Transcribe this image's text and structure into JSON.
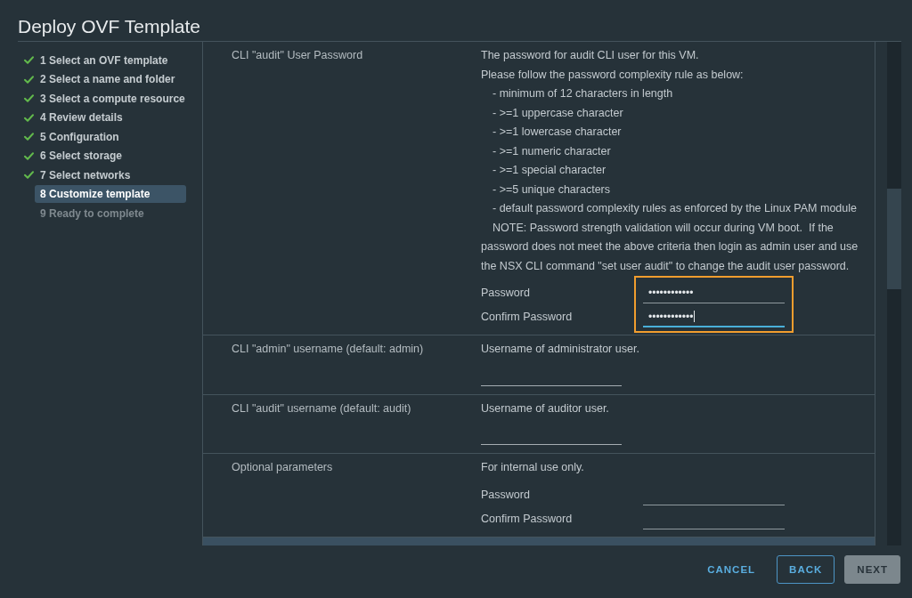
{
  "window": {
    "title": "Deploy OVF Template"
  },
  "steps": [
    {
      "label": "1 Select an OVF template",
      "done": true,
      "selected": false,
      "disabled": false
    },
    {
      "label": "2 Select a name and folder",
      "done": true,
      "selected": false,
      "disabled": false
    },
    {
      "label": "3 Select a compute resource",
      "done": true,
      "selected": false,
      "disabled": false
    },
    {
      "label": "4 Review details",
      "done": true,
      "selected": false,
      "disabled": false
    },
    {
      "label": "5 Configuration",
      "done": true,
      "selected": false,
      "disabled": false
    },
    {
      "label": "6 Select storage",
      "done": true,
      "selected": false,
      "disabled": false
    },
    {
      "label": "7 Select networks",
      "done": true,
      "selected": false,
      "disabled": false
    },
    {
      "label": "8 Customize template",
      "done": false,
      "selected": true,
      "disabled": false
    },
    {
      "label": "9 Ready to complete",
      "done": false,
      "selected": false,
      "disabled": true
    }
  ],
  "sections": [
    {
      "kind": "credentials",
      "label": "CLI \"audit\" User Password",
      "description": [
        {
          "kind": "para",
          "text": "The password for audit CLI user for this VM."
        },
        {
          "kind": "para",
          "text": "Please follow the password complexity rule as below:"
        },
        {
          "kind": "item",
          "text": "- minimum of 12 characters in length"
        },
        {
          "kind": "item",
          "text": "- >=1 uppercase character"
        },
        {
          "kind": "item",
          "text": "- >=1 lowercase character"
        },
        {
          "kind": "item",
          "text": "- >=1 numeric character"
        },
        {
          "kind": "item",
          "text": "- >=1 special character"
        },
        {
          "kind": "item",
          "text": "- >=5 unique characters"
        },
        {
          "kind": "item",
          "text": "- default password complexity rules as enforced by the Linux PAM module"
        },
        {
          "kind": "note",
          "text": "NOTE: Password strength validation will occur during VM boot.  If the password does not meet the above criteria then login as admin user and use the NSX CLI command \"set user audit\" to change the audit user password."
        }
      ],
      "highlighted": true,
      "fields": [
        {
          "label": "Password",
          "value": "••••••••••••",
          "focused": false
        },
        {
          "label": "Confirm Password",
          "value": "••••••••••••",
          "focused": true
        }
      ]
    },
    {
      "kind": "input",
      "label": "CLI \"admin\" username (default: admin)",
      "description": [
        {
          "kind": "para",
          "text": "Username of administrator user."
        }
      ],
      "fields": [
        {
          "focused": false
        }
      ]
    },
    {
      "kind": "input",
      "label": "CLI \"audit\" username (default: audit)",
      "description": [
        {
          "kind": "para",
          "text": "Username of auditor user."
        }
      ],
      "fields": [
        {
          "focused": false
        }
      ]
    },
    {
      "kind": "credentials",
      "label": "Optional parameters",
      "description": [
        {
          "kind": "para",
          "text": "For internal use only."
        }
      ],
      "fields": [
        {
          "label": "Password",
          "focused": false
        },
        {
          "label": "Confirm Password",
          "focused": false
        }
      ]
    },
    {
      "kind": "group"
    }
  ],
  "footer": {
    "buttons": [
      {
        "kind": "cancel",
        "label": "CANCEL",
        "disabled": false
      },
      {
        "kind": "back",
        "label": "BACK",
        "disabled": false
      },
      {
        "kind": "next",
        "label": "NEXT",
        "disabled": true
      }
    ]
  }
}
